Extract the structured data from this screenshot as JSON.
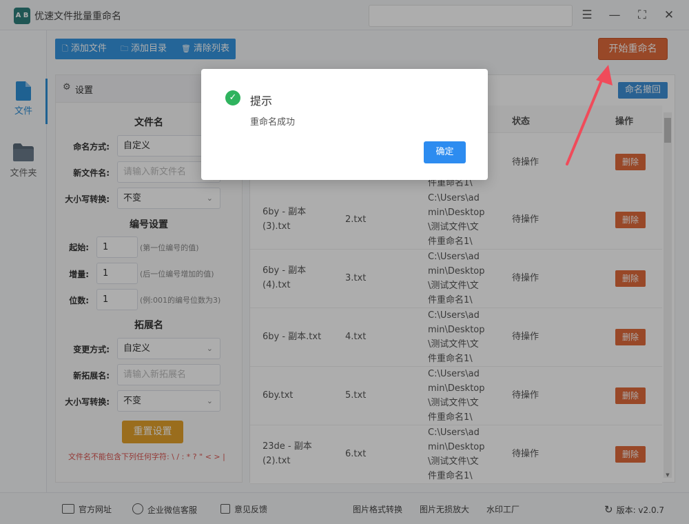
{
  "app": {
    "title": "优速文件批量重命名",
    "logo_text": "A B"
  },
  "window_controls": {
    "menu": "☰",
    "minimize": "—",
    "maximize": "⛶",
    "close": "✕"
  },
  "nav": [
    {
      "label": "文件",
      "icon": "file-icon"
    },
    {
      "label": "文件夹",
      "icon": "folder-icon"
    }
  ],
  "toolbar": {
    "add_file": "添加文件",
    "add_dir": "添加目录",
    "clear_list": "清除列表"
  },
  "start_button": "开始重命名",
  "settings": {
    "title": "设置",
    "filename_section": "文件名",
    "naming_mode_label": "命名方式:",
    "naming_mode_value": "自定义",
    "new_name_label": "新文件名:",
    "new_name_placeholder": "请输入新文件名",
    "case_label": "大小写转换:",
    "case_value": "不变",
    "numbering_section": "编号设置",
    "start_label": "起始:",
    "start_value": "1",
    "start_hint": "(第一位编号的值)",
    "step_label": "增量:",
    "step_value": "1",
    "step_hint": "(后一位编号增加的值)",
    "digits_label": "位数:",
    "digits_value": "1",
    "digits_hint": "(例:001的编号位数为3)",
    "ext_section": "拓展名",
    "ext_mode_label": "变更方式:",
    "ext_mode_value": "自定义",
    "new_ext_label": "新拓展名:",
    "new_ext_placeholder": "请输入新拓展名",
    "ext_case_label": "大小写转换:",
    "ext_case_value": "不变",
    "reset_button": "重置设置",
    "warning": "文件名不能包含下列任何字符: \\ / : * ? \" < > |"
  },
  "table": {
    "undo_button": "命名撤回",
    "headers": {
      "status": "状态",
      "action": "操作"
    },
    "rows": [
      {
        "name_l1": "",
        "name_l2": "",
        "new_name": "",
        "path": [
          "件重命名1\\"
        ],
        "status": "待操作",
        "action": "删除"
      },
      {
        "name_l1": "6by - 副本",
        "name_l2": "(3).txt",
        "new_name": "2.txt",
        "path": [
          "C:\\Users\\ad",
          "min\\Desktop",
          "\\测试文件\\文",
          "件重命名1\\"
        ],
        "status": "待操作",
        "action": "删除"
      },
      {
        "name_l1": "6by - 副本",
        "name_l2": "(4).txt",
        "new_name": "3.txt",
        "path": [
          "C:\\Users\\ad",
          "min\\Desktop",
          "\\测试文件\\文",
          "件重命名1\\"
        ],
        "status": "待操作",
        "action": "删除"
      },
      {
        "name_l1": "6by - 副本.txt",
        "name_l2": "",
        "new_name": "4.txt",
        "path": [
          "C:\\Users\\ad",
          "min\\Desktop",
          "\\测试文件\\文",
          "件重命名1\\"
        ],
        "status": "待操作",
        "action": "删除"
      },
      {
        "name_l1": "6by.txt",
        "name_l2": "",
        "new_name": "5.txt",
        "path": [
          "C:\\Users\\ad",
          "min\\Desktop",
          "\\测试文件\\文",
          "件重命名1\\"
        ],
        "status": "待操作",
        "action": "删除"
      },
      {
        "name_l1": "23de - 副本",
        "name_l2": "(2).txt",
        "new_name": "6.txt",
        "path": [
          "C:\\Users\\ad",
          "min\\Desktop",
          "\\测试文件\\文",
          "件重命名1\\"
        ],
        "status": "待操作",
        "action": "删除"
      }
    ]
  },
  "footer": {
    "website": "官方网址",
    "wechat": "企业微信客服",
    "feedback": "意见反馈",
    "img_convert": "图片格式转换",
    "img_enlarge": "图片无损放大",
    "watermark": "水印工厂",
    "version": "版本: v2.0.7"
  },
  "dialog": {
    "title": "提示",
    "message": "重命名成功",
    "ok": "确定"
  },
  "colors": {
    "accent": "#2d8cf0",
    "danger": "#e06a3b",
    "success": "#2fb35e",
    "warning_btn": "#e4a12c"
  }
}
